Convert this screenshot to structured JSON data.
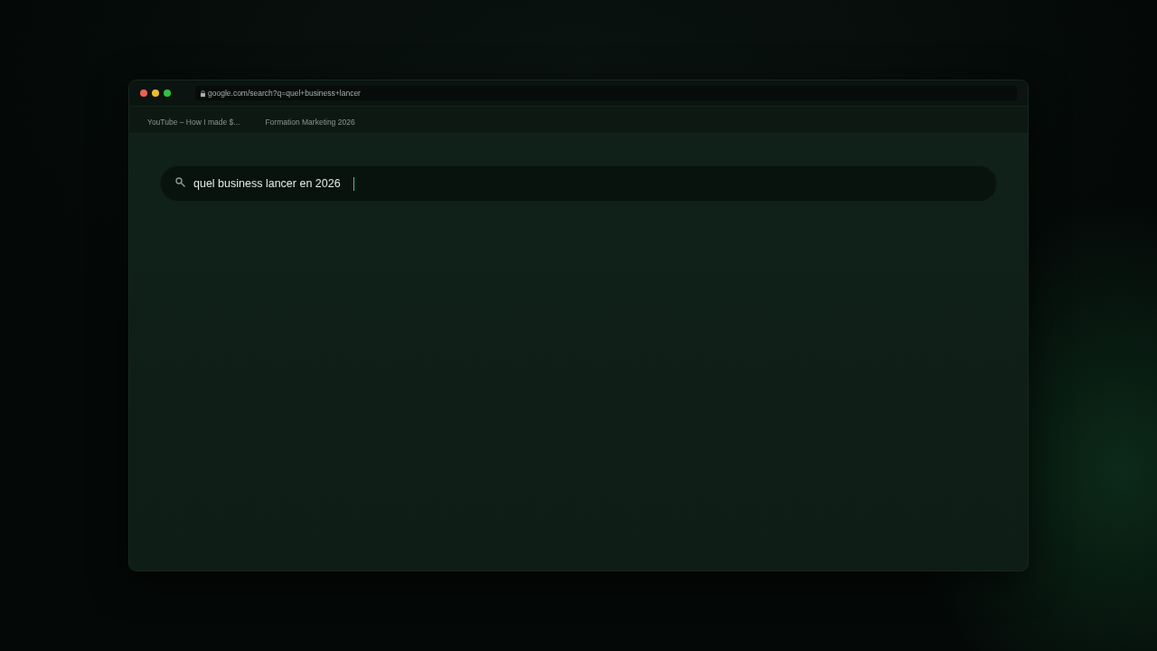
{
  "address_bar": {
    "url": "google.com/search?q=quel+business+lancer",
    "secure": true
  },
  "tabs": [
    {
      "label": "YouTube – How I made $...",
      "selected": false
    },
    {
      "label": "Formation Marketing 2026",
      "selected": false
    }
  ],
  "search": {
    "value": "quel business lancer en 2026",
    "focused": true
  }
}
